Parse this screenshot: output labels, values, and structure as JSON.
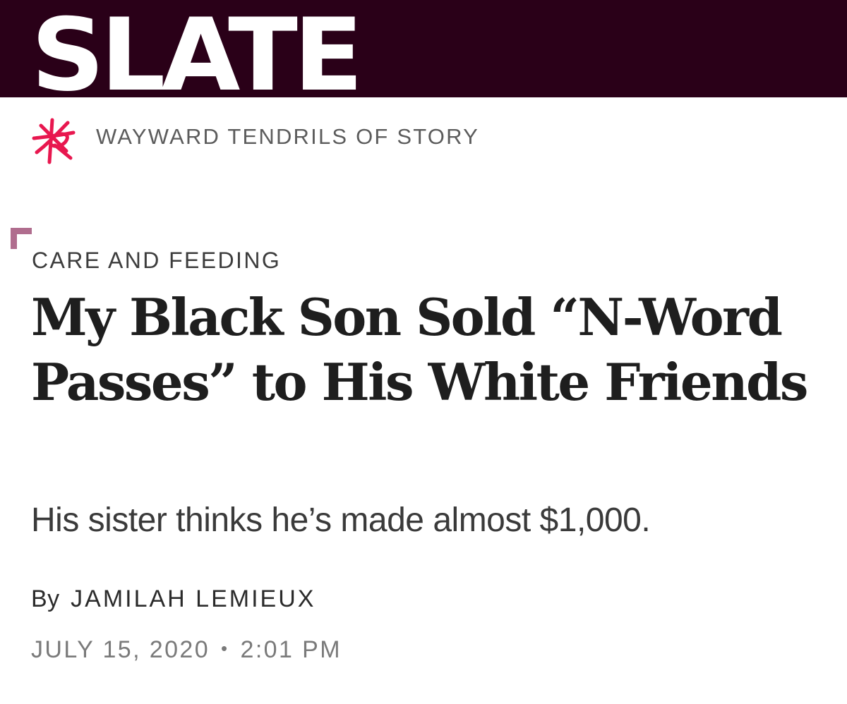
{
  "header": {
    "logo_text": "SLATE",
    "background_color": "#2a0018",
    "logo_color": "#ffffff"
  },
  "series": {
    "icon": "wayward-tendrils-icon",
    "icon_color": "#e8174f",
    "label": "WAYWARD TENDRILS OF STORY"
  },
  "article": {
    "rubric": "CARE AND FEEDING",
    "headline": "My Black Son Sold “N-Word Passes” to His White Friends",
    "dek": "His sister thinks he’s made almost $1,000.",
    "byline_prefix": "By",
    "author": "JAMILAH LEMIEUX",
    "date": "JULY 15, 2020",
    "separator": "•",
    "time": "2:01 PM",
    "accent_color": "#b06d8e"
  }
}
